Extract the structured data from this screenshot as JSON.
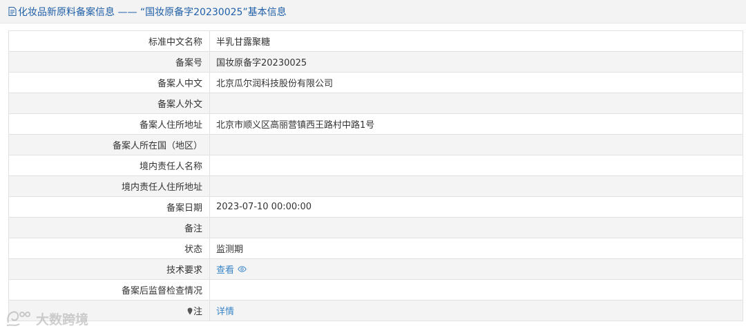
{
  "header": {
    "title": "化妆品新原料备案信息 —— “国妆原备字20230025”基本信息",
    "icon": "document-icon",
    "color": "#1f5fa8"
  },
  "rows": [
    {
      "label": "标准中文名称",
      "value": "半乳甘露聚糖"
    },
    {
      "label": "备案号",
      "value": "国妆原备字20230025"
    },
    {
      "label": "备案人中文",
      "value": "北京瓜尔润科技股份有限公司"
    },
    {
      "label": "备案人外文",
      "value": ""
    },
    {
      "label": "备案人住所地址",
      "value": "北京市顺义区高丽营镇西王路村中路1号"
    },
    {
      "label": "备案人所在国（地区）",
      "value": ""
    },
    {
      "label": "境内责任人名称",
      "value": ""
    },
    {
      "label": "境内责任人住所地址",
      "value": ""
    },
    {
      "label": "备案日期",
      "value": "2023-07-10 00:00:00"
    },
    {
      "label": "备注",
      "value": ""
    },
    {
      "label": "状态",
      "value": "监测期"
    },
    {
      "label": "技术要求",
      "link_text": "查看",
      "icon": "eye-icon"
    },
    {
      "label": "备案后监督检查情况",
      "value": ""
    },
    {
      "label": "注",
      "label_icon": "pin-icon",
      "link_text": "详情"
    }
  ],
  "watermark": {
    "text": "大数跨境",
    "icon": "brand-logo-icon"
  },
  "colors": {
    "link": "#3a86c8",
    "row_alt": "#f4f4f4",
    "border": "#e1e1e1"
  }
}
